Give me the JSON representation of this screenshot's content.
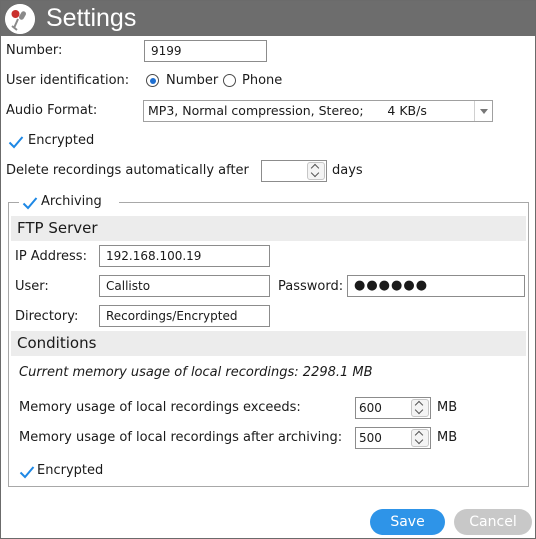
{
  "window": {
    "title": "Settings"
  },
  "number": {
    "label": "Number:",
    "value": "9199"
  },
  "user_identification": {
    "label": "User identification:",
    "options": [
      {
        "label": "Number",
        "selected": true
      },
      {
        "label": "Phone",
        "selected": false
      }
    ]
  },
  "audio_format": {
    "label": "Audio Format:",
    "value": "MP3, Normal compression, Stereo;      4 KB/s"
  },
  "encrypted": {
    "label": "Encrypted",
    "checked": true
  },
  "delete_recordings": {
    "label": "Delete recordings automatically after",
    "value": "",
    "unit": "days"
  },
  "archiving": {
    "label": "Archiving",
    "checked": true,
    "ftp": {
      "title": "FTP Server",
      "ip_label": "IP Address:",
      "ip_value": "192.168.100.19",
      "user_label": "User:",
      "user_value": "Callisto",
      "password_label": "Password:",
      "password_value": "●●●●●●",
      "directory_label": "Directory:",
      "directory_value": "Recordings/Encrypted"
    },
    "conditions": {
      "title": "Conditions",
      "current_usage": "Current memory usage of local recordings: 2298.1 MB",
      "exceeds_label": "Memory usage of local recordings exceeds:",
      "exceeds_value": "600",
      "exceeds_unit": "MB",
      "after_label": "Memory usage of local recordings after archiving:",
      "after_value": "500",
      "after_unit": "MB",
      "encrypted_label": "Encrypted",
      "encrypted_checked": true
    }
  },
  "buttons": {
    "save": "Save",
    "cancel": "Cancel"
  },
  "colors": {
    "titlebar": "#6d6d6d",
    "accent": "#2e94e8",
    "check": "#1e88e5",
    "disabled": "#c8c8c8"
  },
  "icons": {
    "app": "microphone-icon",
    "check": "check-icon"
  }
}
